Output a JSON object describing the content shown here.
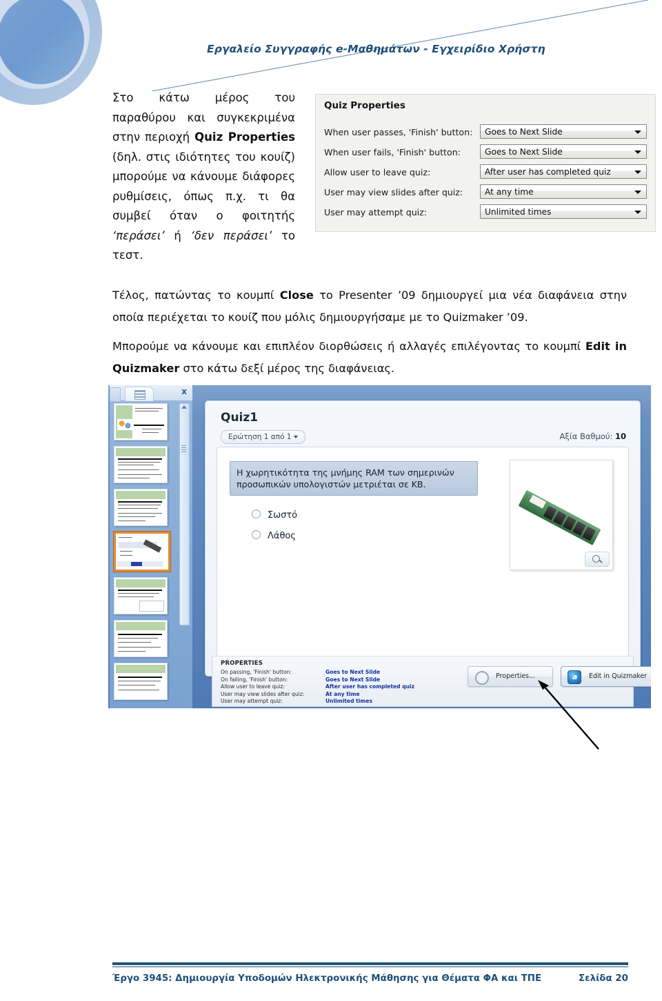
{
  "header": {
    "title": "Εργαλείο Συγγραφής e-Μαθημάτων - Εγχειρίδιο Χρήστη",
    "logo_icon": "concentric-circles-logo",
    "title_color": "#1f4e79"
  },
  "intro": {
    "part1": "Στο κάτω μέρος του παραθύρου και συγκεκριμένα στην περιοχή ",
    "bold1": "Quiz Properties",
    "part2": " (δηλ. στις ιδιότητες του κουίζ) μπορούμε να κάνουμε διάφορες ρυθμίσεις, όπως π.χ. τι θα συμβεί όταν ο φοιτητής ",
    "italic1": "‘περάσει’",
    "part3": " ή ",
    "italic2": "‘δεν περάσει’",
    "part4": " το τεστ."
  },
  "quiz_properties": {
    "panel_title": "Quiz Properties",
    "rows": [
      {
        "label": "When user passes, 'Finish' button:",
        "value": "Goes to Next Slide"
      },
      {
        "label": "When user fails, 'Finish' button:",
        "value": "Goes to Next Slide"
      },
      {
        "label": "Allow user to leave quiz:",
        "value": "After user has completed quiz"
      },
      {
        "label": "User may view slides after quiz:",
        "value": "At any time"
      },
      {
        "label": "User may attempt quiz:",
        "value": "Unlimited times"
      }
    ]
  },
  "paragraphs": {
    "p1_a": "Τέλος, πατώντας το κουμπί ",
    "p1_b": "Close",
    "p1_c": " το Presenter ’09 δημιουργεί μια νέα διαφάνεια στην οποία περιέχεται το κουίζ που μόλις δημιουργήσαμε με το Quizmaker ’09.",
    "p2_a": "Μπορούμε να κάνουμε και επιπλέον διορθώσεις ή αλλαγές επιλέγοντας το κουμπί ",
    "p2_b": "Edit in Quizmaker",
    "p2_c": " στο κάτω δεξί μέρος της διαφάνειας."
  },
  "figure": {
    "thumbnail_pane": {
      "close_label": "x",
      "tab_icon": "slides-outline-icon",
      "thumbnails": [
        {
          "index": 1,
          "selected": false
        },
        {
          "index": 2,
          "selected": false
        },
        {
          "index": 3,
          "selected": false
        },
        {
          "index": 4,
          "selected": true
        },
        {
          "index": 5,
          "selected": false
        },
        {
          "index": 6,
          "selected": false
        },
        {
          "index": 7,
          "selected": false
        }
      ]
    },
    "slide": {
      "quiz_title": "Quiz1",
      "question_nav": "Ερώτηση 1 από 1",
      "score_label": "Αξία Βαθμού:",
      "score_value": "10",
      "question_text": "Η χωρητικότητα της μνήμης RAM των σημερινών προσωπικών υπολογιστών μετριέται σε KB.",
      "options": [
        {
          "label": "Σωστό",
          "selected": false
        },
        {
          "label": "Λάθος",
          "selected": false
        }
      ],
      "image_alt": "ram-memory-module",
      "zoom_icon": "magnifier-icon"
    },
    "properties_strip": {
      "title": "PROPERTIES",
      "rows": [
        {
          "label": "On passing, 'Finish' button:",
          "value": "Goes to Next Slide"
        },
        {
          "label": "On failing, 'Finish' button:",
          "value": "Goes to Next Slide"
        },
        {
          "label": "Allow user to leave quiz:",
          "value": "After user has completed quiz"
        },
        {
          "label": "User may view slides after quiz:",
          "value": "At any time"
        },
        {
          "label": "User may attempt quiz:",
          "value": "Unlimited times"
        }
      ],
      "properties_button": "Properties...",
      "edit_button": "Edit in Quizmaker",
      "gear_icon": "gear-icon",
      "quizmaker_icon": "quizmaker-icon",
      "cursor_icon": "mouse-pointer-icon"
    },
    "annotation_icon": "callout-arrow-icon"
  },
  "footer": {
    "left": "Έργο 3945: Δημιουργία Υποδομών Ηλεκτρονικής Μάθησης για Θέματα ΦΑ και ΤΠΕ",
    "right": "Σελίδα 20",
    "rule_color": "#22527e"
  }
}
